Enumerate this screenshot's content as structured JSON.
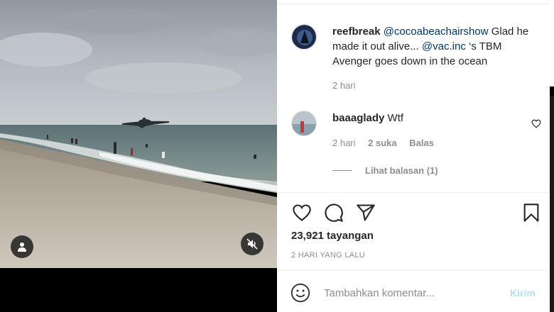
{
  "post": {
    "caption_user": "reefbreak",
    "caption_mention_1": "@cocoabeachairshow",
    "caption_text_1": " Glad he made it out alive... ",
    "caption_mention_2": "@vac.inc",
    "caption_text_2": " ‘s TBM Avenger goes down in the ocean",
    "caption_time": "2 hari"
  },
  "comment": {
    "user": "baaaglady",
    "text": "Wtf",
    "time": "2 hari",
    "likes": "2 suka",
    "reply": "Balas",
    "view_replies": "Lihat balasan (1)"
  },
  "stats": {
    "views": "23,921 tayangan",
    "date": "2 HARI YANG LALU"
  },
  "add_comment": {
    "placeholder": "Tambahkan komentar...",
    "post_label": "Kirim"
  },
  "icons": {
    "user_tag": "user-tag-icon",
    "mute": "speaker-muted-icon",
    "like": "heart-icon",
    "comment": "comment-bubble-icon",
    "share": "paper-plane-icon",
    "save": "bookmark-icon",
    "emoji": "smiley-icon"
  },
  "colors": {
    "mention": "#00376b",
    "meta_gray": "#8e8e8e",
    "post_button_disabled": "#b2dffc"
  }
}
